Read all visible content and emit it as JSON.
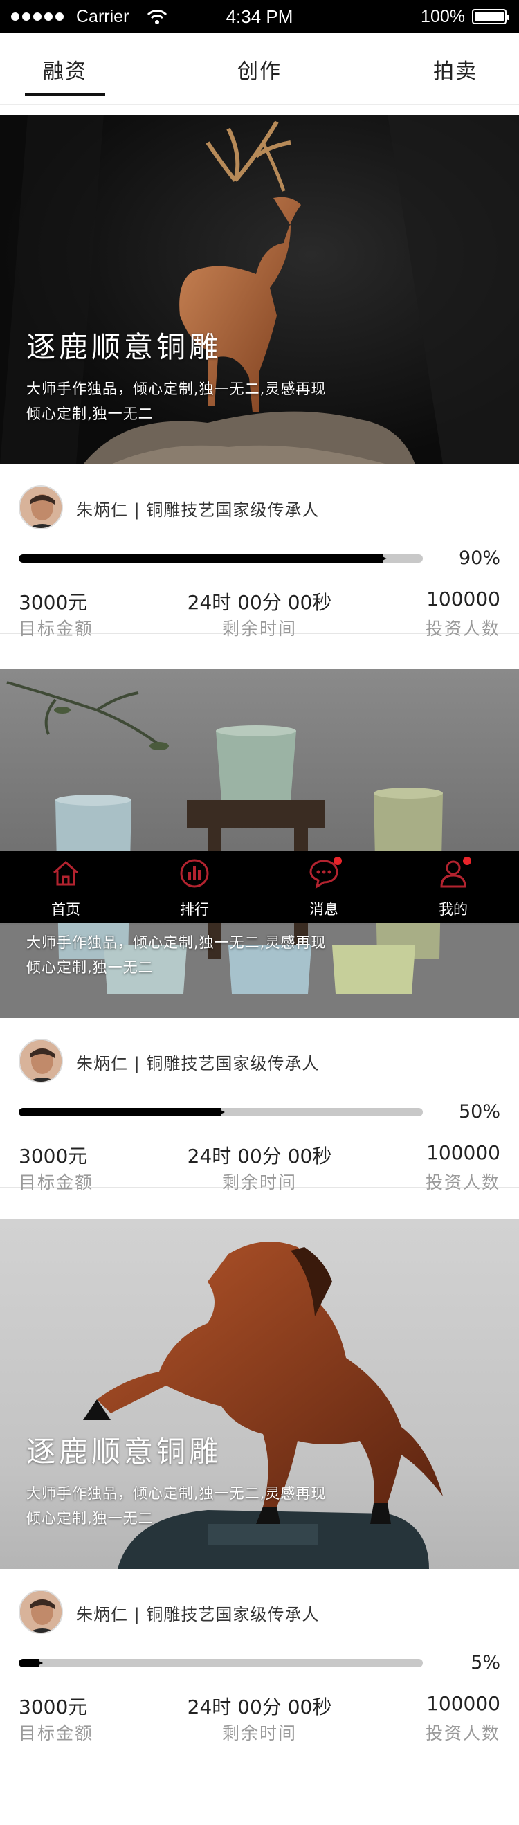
{
  "status_bar": {
    "carrier": "Carrier",
    "time": "4:34 PM",
    "battery": "100%"
  },
  "top_nav": {
    "tabs": [
      {
        "label": "融资",
        "active": true
      },
      {
        "label": "创作",
        "active": false
      },
      {
        "label": "拍卖",
        "active": false
      }
    ]
  },
  "projects": [
    {
      "image": "deer-bronze-sculpture",
      "title": "逐鹿顺意铜雕",
      "description": [
        "大师手作独品，倾心定制,独一无二,灵感再现",
        "倾心定制,独一无二"
      ],
      "artist": "朱炳仁 | 铜雕技艺国家级传承人",
      "progress": 0.9,
      "progress_label": "90%",
      "stats": [
        {
          "value": "3000元",
          "label": "目标金额"
        },
        {
          "value": "24时 00分 00秒",
          "label": "剩余时间"
        },
        {
          "value": "100000",
          "label": "投资人数"
        }
      ]
    },
    {
      "image": "celadon-cups",
      "title": "",
      "description": [
        "大师手作独品，倾心定制,独一无二,灵感再现",
        "倾心定制,独一无二"
      ],
      "artist": "朱炳仁 | 铜雕技艺国家级传承人",
      "progress": 0.5,
      "progress_label": "50%",
      "stats": [
        {
          "value": "3000元",
          "label": "目标金额"
        },
        {
          "value": "24时 00分 00秒",
          "label": "剩余时间"
        },
        {
          "value": "100000",
          "label": "投资人数"
        }
      ]
    },
    {
      "image": "horse-wood-carving",
      "title": "逐鹿顺意铜雕",
      "description": [
        "大师手作独品，倾心定制,独一无二,灵感再现",
        "倾心定制,独一无二"
      ],
      "artist": "朱炳仁 | 铜雕技艺国家级传承人",
      "progress": 0.05,
      "progress_label": "5%",
      "stats": [
        {
          "value": "3000元",
          "label": "目标金额"
        },
        {
          "value": "24时 00分 00秒",
          "label": "剩余时间"
        },
        {
          "value": "100000",
          "label": "投资人数"
        }
      ]
    }
  ],
  "tab_bar": {
    "items": [
      {
        "label": "首页",
        "icon": "home-icon",
        "badge": false
      },
      {
        "label": "排行",
        "icon": "ranking-icon",
        "badge": false
      },
      {
        "label": "消息",
        "icon": "message-icon",
        "badge": true
      },
      {
        "label": "我的",
        "icon": "profile-icon",
        "badge": true
      }
    ],
    "accent": "#b3232f",
    "badge_color": "#e8242a"
  }
}
